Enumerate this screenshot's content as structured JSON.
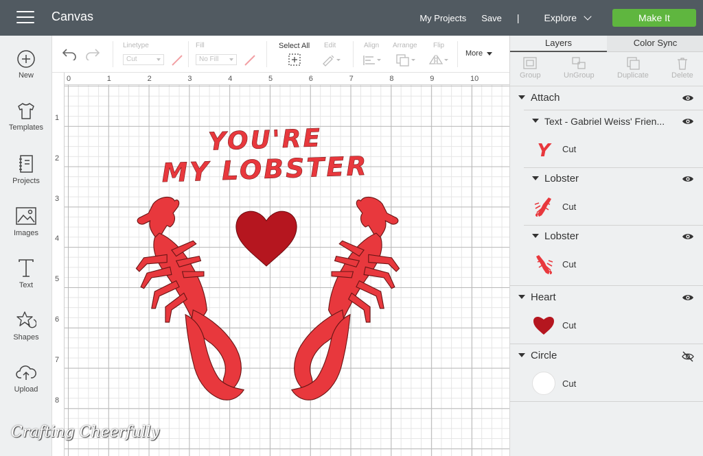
{
  "header": {
    "title": "Canvas",
    "my_projects": "My Projects",
    "save": "Save",
    "separator": "|",
    "explore": "Explore",
    "make_it": "Make It",
    "accent_color": "#5fb63f",
    "bar_color": "#515a61"
  },
  "sidebar": {
    "items": [
      {
        "label": "New",
        "icon": "plus-circle-icon"
      },
      {
        "label": "Templates",
        "icon": "tshirt-icon"
      },
      {
        "label": "Projects",
        "icon": "notebook-icon"
      },
      {
        "label": "Images",
        "icon": "image-icon"
      },
      {
        "label": "Text",
        "icon": "text-t-icon"
      },
      {
        "label": "Shapes",
        "icon": "shapes-icon"
      },
      {
        "label": "Upload",
        "icon": "cloud-upload-icon"
      }
    ]
  },
  "toolbar": {
    "linetype_label": "Linetype",
    "linetype_value": "Cut",
    "fill_label": "Fill",
    "fill_value": "No Fill",
    "select_all": "Select All",
    "edit": "Edit",
    "align": "Align",
    "arrange": "Arrange",
    "flip": "Flip",
    "more": "More"
  },
  "canvas": {
    "ruler_top": [
      "0",
      "1",
      "2",
      "3",
      "4",
      "5",
      "6",
      "7",
      "8",
      "9",
      "10"
    ],
    "ruler_left": [
      "1",
      "2",
      "3",
      "4",
      "5",
      "6",
      "7",
      "8"
    ],
    "design_text_line1": "YOU'RE",
    "design_text_line2": "MY LOBSTER",
    "design_color": "#e8383d",
    "heart_color": "#b5161f",
    "watermark": "Crafting Cheerfully"
  },
  "panel": {
    "tabs": [
      "Layers",
      "Color Sync"
    ],
    "tools": [
      "Group",
      "UnGroup",
      "Duplicate",
      "Delete"
    ],
    "groups": {
      "attach": "Attach",
      "text_layer": "Text - Gabriel Weiss' Frien...",
      "lobster1": "Lobster",
      "lobster2": "Lobster",
      "heart": "Heart",
      "circle": "Circle"
    },
    "cut_label": "Cut",
    "text_thumb_glyph": "Y"
  }
}
